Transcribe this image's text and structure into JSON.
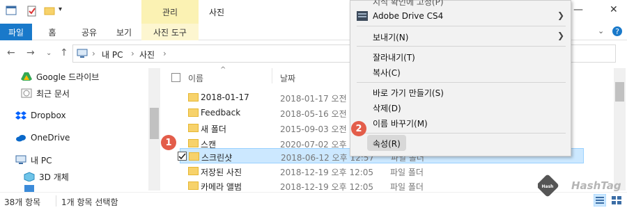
{
  "titlebar": {
    "context_tab": "관리",
    "title": "사진"
  },
  "ribbon": {
    "tabs": [
      "파일",
      "홈",
      "공유",
      "보기",
      "사진 도구"
    ]
  },
  "address": {
    "crumbs": [
      "내 PC",
      "사진"
    ]
  },
  "nav": {
    "items": [
      "Google 드라이브",
      "최근 문서",
      "Dropbox",
      "OneDrive",
      "내 PC",
      "3D 개체"
    ]
  },
  "columns": {
    "name": "이름",
    "date": "날짜"
  },
  "rows": [
    {
      "name": "2018-01-17",
      "date": "2018-01-17 오전",
      "type": ""
    },
    {
      "name": "Feedback",
      "date": "2018-05-16 오전",
      "type": ""
    },
    {
      "name": "새 폴더",
      "date": "2015-09-03 오전",
      "type": ""
    },
    {
      "name": "스캔",
      "date": "2020-07-02 오후",
      "type": ""
    },
    {
      "name": "스크린샷",
      "date": "2018-06-12 오후 12:57",
      "type": "파일 폴더"
    },
    {
      "name": "저장된 사진",
      "date": "2018-12-19 오후 12:05",
      "type": "파일 폴더"
    },
    {
      "name": "카메라 앨범",
      "date": "2018-12-19 오후 12:05",
      "type": "파일 폴더"
    }
  ],
  "status": {
    "count": "38개 항목",
    "selected": "1개 항목 선택함"
  },
  "context_menu": {
    "partial_top": "지식 확인에 고정(P)",
    "adobe": "Adobe Drive CS4",
    "send_to": "보내기(N)",
    "cut": "잘라내기(T)",
    "copy": "복사(C)",
    "shortcut": "바로 가기 만들기(S)",
    "delete": "삭제(D)",
    "rename": "이름 바꾸기(M)",
    "properties": "속성(R)"
  },
  "badges": {
    "one": "1",
    "two": "2"
  },
  "watermark": {
    "hash": "Hash",
    "tag": "HashTag"
  },
  "colors": {
    "accent": "#1979ca",
    "selection": "#cce8ff",
    "context_tab": "#fbf2b3",
    "badge": "#e35d4a"
  }
}
